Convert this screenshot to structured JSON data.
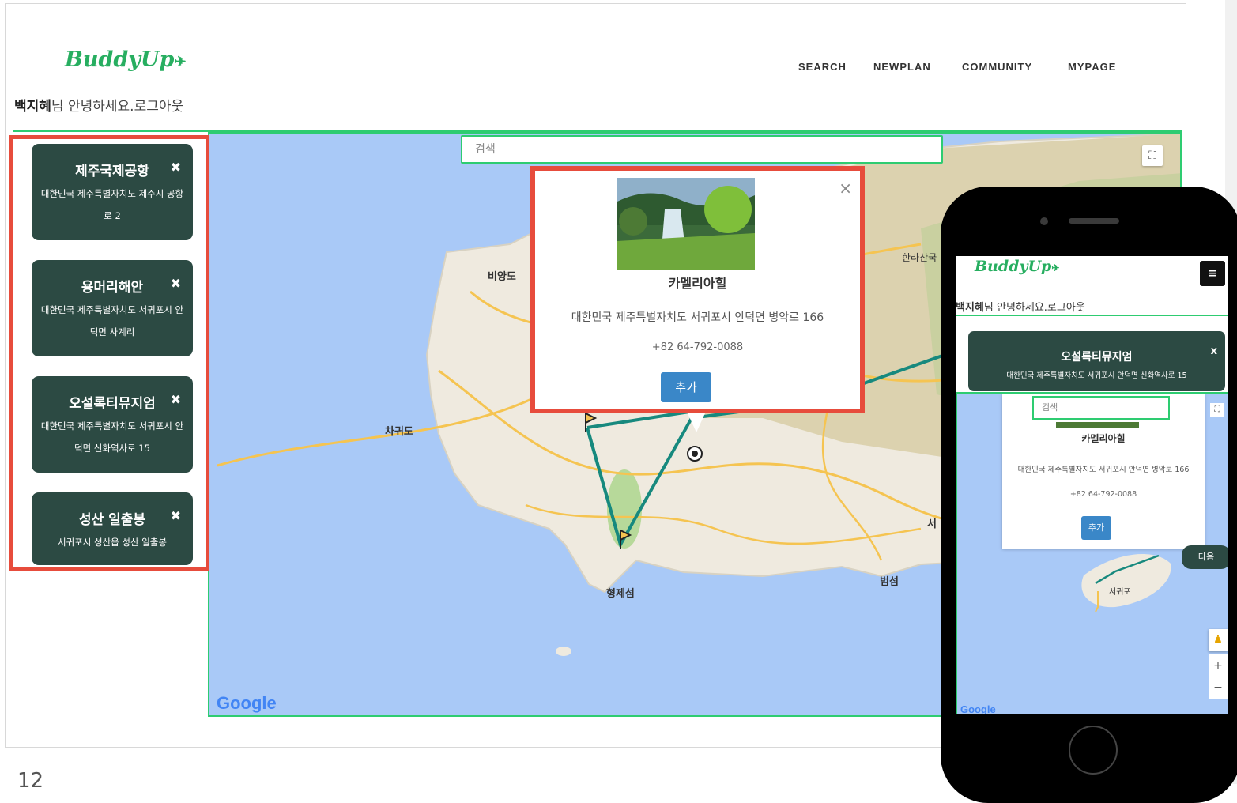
{
  "desktop": {
    "logo": "BuddyUp",
    "nav": [
      "SEARCH",
      "NEWPLAN",
      "COMMUNITY",
      "MYPAGE"
    ],
    "greeting_name": "백지혜",
    "greeting_rest": "님 안녕하세요.로그아웃",
    "search_placeholder": "검색",
    "places": [
      {
        "name": "제주국제공항",
        "address": "대한민국 제주특별자치도 제주시 공항로 2"
      },
      {
        "name": "용머리해안",
        "address": "대한민국 제주특별자치도 서귀포시 안덕면 사계리"
      },
      {
        "name": "오설록티뮤지엄",
        "address": "대한민국 제주특별자치도 서귀포시 안덕면 신화역사로 15"
      },
      {
        "name": "성산 일출봉",
        "address": "서귀포시 성산읍 성산 일출봉"
      }
    ],
    "popup": {
      "title": "카멜리아힐",
      "address": "대한민국 제주특별자치도 서귀포시 안덕면 병악로 166",
      "phone": "+82 64-792-0088",
      "add_label": "추가",
      "close": "×"
    },
    "map_labels": {
      "biyangdo": "비양도",
      "chagwido": "차귀도",
      "hyeongjeseom": "형제섬",
      "beomseom": "범섬",
      "hallasan": "한라산국",
      "seo": "서"
    },
    "google": "Google",
    "remove_icon": "✖"
  },
  "mobile": {
    "logo": "BuddyUp",
    "menu_icon": "≡",
    "greeting_name": "백지혜",
    "greeting_rest": "님 안녕하세요.로그아웃",
    "card": {
      "name": "오설록티뮤지엄",
      "address": "대한민국 제주특별자치도 서귀포시 안덕면 신화역사로 15",
      "close": "x"
    },
    "search_placeholder": "검색",
    "popup": {
      "title": "카멜리아힐",
      "address": "대한민국 제주특별자치도 서귀포시 안덕면 병악로 166",
      "phone": "+82 64-792-0088",
      "add_label": "추가"
    },
    "next_label": "다음",
    "seogwipo": "서귀포",
    "google": "Google"
  },
  "page_number": "12",
  "colors": {
    "brand_green": "#27ae60",
    "card_bg": "#2c4a43",
    "highlight_red": "#e74c3c",
    "button_blue": "#3a87c8",
    "route_teal": "#17897e"
  }
}
